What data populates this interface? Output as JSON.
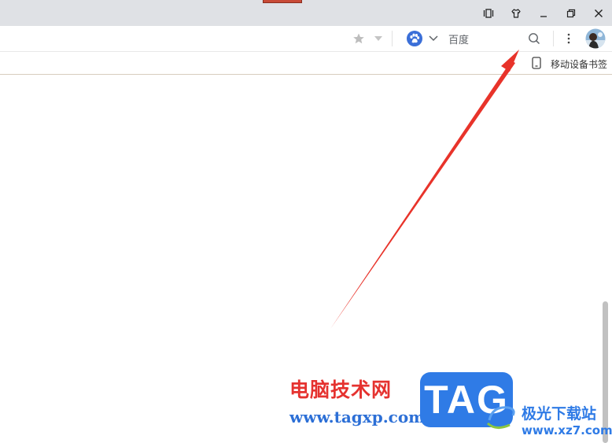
{
  "window": {
    "controls": [
      {
        "name": "vertical-tabs-icon"
      },
      {
        "name": "skin-shirt-icon"
      },
      {
        "name": "minimize-icon"
      },
      {
        "name": "restore-icon"
      },
      {
        "name": "close-icon"
      }
    ]
  },
  "toolbar": {
    "search_engine_name": "百度",
    "icons": [
      "star-icon",
      "chevron-down-icon",
      "baidu-paw-icon",
      "search-icon",
      "more-menu-icon",
      "avatar"
    ]
  },
  "bookmark_bar": {
    "mobile_bookmarks_label": "移动设备书签"
  },
  "watermark": {
    "title_cn": "电脑技术网",
    "url": "www.tagxp.com",
    "tag_text": "TAG",
    "site_cn": "极光下载站",
    "site_url": "www.xz7.com"
  },
  "colors": {
    "titlebar": "#dfe1e5",
    "arrow": "#e8332a",
    "watermark_red": "#e5322f",
    "watermark_blue": "#2f7be6"
  }
}
